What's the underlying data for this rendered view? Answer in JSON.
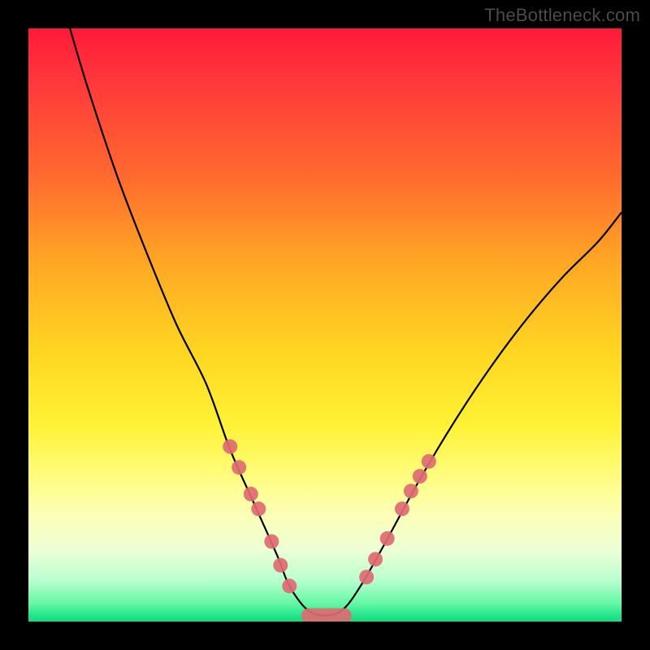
{
  "attribution": "TheBottleneck.com",
  "chart_data": {
    "type": "line",
    "title": "",
    "xlabel": "",
    "ylabel": "",
    "xlim": [
      0,
      100
    ],
    "ylim": [
      0,
      100
    ],
    "curve": {
      "name": "bottleneck-curve",
      "x": [
        7,
        10,
        15,
        20,
        25,
        30,
        34,
        38,
        42,
        44,
        47,
        50,
        53,
        56,
        60,
        66,
        72,
        78,
        84,
        90,
        96,
        100
      ],
      "y": [
        100,
        90,
        75,
        62,
        50,
        40,
        29,
        20,
        11,
        6,
        2,
        1,
        2,
        6,
        13,
        24,
        34,
        43,
        51,
        58,
        64,
        69
      ]
    },
    "markers_left": {
      "name": "left-cluster-points",
      "color": "#e06a72",
      "points": [
        {
          "x": 34.0,
          "y": 29.5
        },
        {
          "x": 35.5,
          "y": 26.0
        },
        {
          "x": 37.5,
          "y": 21.5
        },
        {
          "x": 38.8,
          "y": 19.0
        },
        {
          "x": 41.0,
          "y": 13.5
        },
        {
          "x": 42.5,
          "y": 9.5
        },
        {
          "x": 44.0,
          "y": 6.0
        }
      ]
    },
    "markers_right": {
      "name": "right-cluster-points",
      "color": "#e06a72",
      "points": [
        {
          "x": 57.0,
          "y": 7.5
        },
        {
          "x": 58.5,
          "y": 10.5
        },
        {
          "x": 60.5,
          "y": 14.0
        },
        {
          "x": 63.0,
          "y": 19.0
        },
        {
          "x": 64.5,
          "y": 22.0
        },
        {
          "x": 66.0,
          "y": 24.5
        },
        {
          "x": 67.5,
          "y": 27.0
        }
      ]
    },
    "valley_bar": {
      "name": "valley-flat-segment",
      "color": "#e06a72",
      "x_start": 46.0,
      "x_end": 54.5,
      "y": 1.0,
      "thickness": 2.5
    }
  }
}
